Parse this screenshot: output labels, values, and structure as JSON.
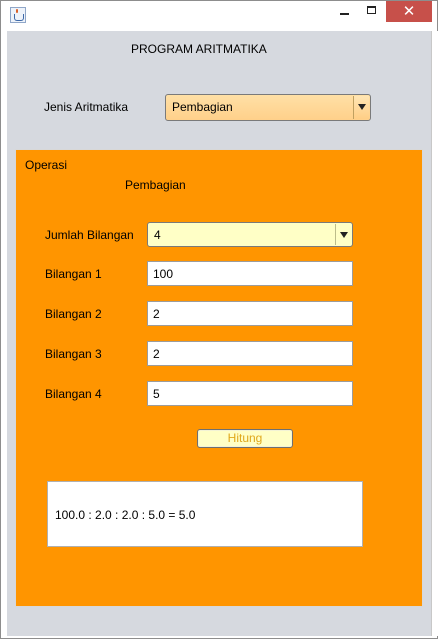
{
  "window": {
    "icon": "java-cup-icon",
    "controls": {
      "minimize": "minimize-icon",
      "maximize": "maximize-icon",
      "close": "close-icon",
      "close_glyph": "✕"
    }
  },
  "header": {
    "title": "PROGRAM ARITMATIKA"
  },
  "jenis": {
    "label": "Jenis Aritmatika",
    "selected": "Pembagian"
  },
  "panel": {
    "title": "Operasi",
    "operation_name": "Pembagian",
    "jumlah": {
      "label": "Jumlah Bilangan",
      "selected": "4"
    },
    "fields": [
      {
        "label": "Bilangan 1",
        "value": "100"
      },
      {
        "label": "Bilangan 2",
        "value": "2"
      },
      {
        "label": "Bilangan 3",
        "value": "2"
      },
      {
        "label": "Bilangan 4",
        "value": "5"
      }
    ],
    "button_label": "Hitung",
    "result": "100.0 : 2.0 : 2.0 : 5.0 = 5.0"
  },
  "colors": {
    "panel_bg": "#ff9500",
    "frame_bg": "#d6d9df",
    "combo_jenis_bg": "#ffd08a",
    "combo_jumlah_bg": "#ffffc6",
    "close_button": "#c7504a",
    "button_text": "#e0a81b"
  }
}
